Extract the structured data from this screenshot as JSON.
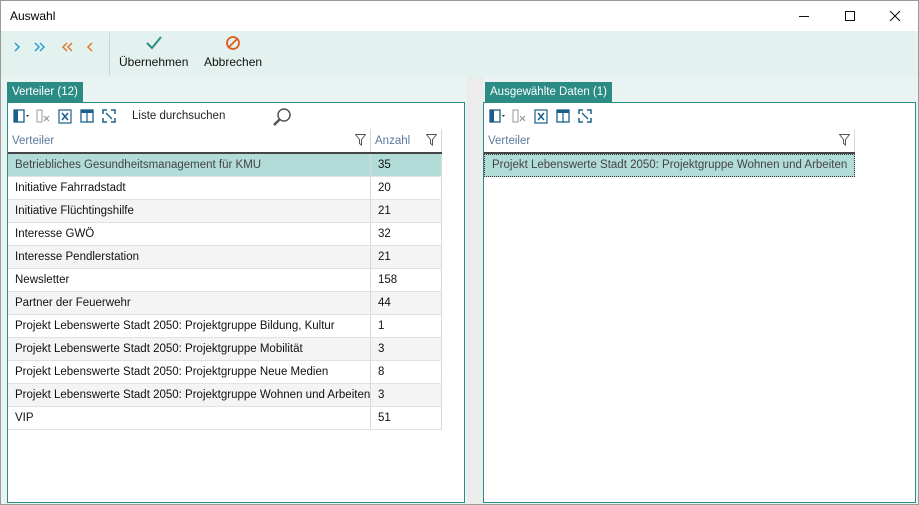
{
  "window": {
    "title": "Auswahl"
  },
  "toolbar": {
    "accept_label": "Übernehmen",
    "cancel_label": "Abbrechen",
    "accent_color": "#2b8c86",
    "nav_color_add": "#2a9fd6",
    "nav_color_remove": "#e07b2a"
  },
  "left_pane": {
    "tab_label": "Verteiler (12)",
    "search_label": "Liste durchsuchen",
    "columns": [
      "Verteiler",
      "Anzahl"
    ],
    "rows": [
      {
        "name": "Betriebliches Gesundheitsmanagement für KMU",
        "count": "35",
        "selected": true
      },
      {
        "name": "Initiative Fahrradstadt",
        "count": "20"
      },
      {
        "name": "Initiative Flüchtingshilfe",
        "count": "21"
      },
      {
        "name": "Interesse GWÖ",
        "count": "32"
      },
      {
        "name": "Interesse Pendlerstation",
        "count": "21"
      },
      {
        "name": "Newsletter",
        "count": "158"
      },
      {
        "name": "Partner der Feuerwehr",
        "count": "44"
      },
      {
        "name": "Projekt Lebenswerte Stadt 2050: Projektgruppe Bildung, Kultur",
        "count": "1"
      },
      {
        "name": "Projekt Lebenswerte Stadt 2050: Projektgruppe Mobilität",
        "count": "3"
      },
      {
        "name": "Projekt Lebenswerte Stadt 2050: Projektgruppe Neue Medien",
        "count": "8"
      },
      {
        "name": "Projekt Lebenswerte Stadt 2050: Projektgruppe Wohnen und Arbeiten",
        "count": "3"
      },
      {
        "name": "VIP",
        "count": "51"
      }
    ]
  },
  "right_pane": {
    "tab_label": "Ausgewählte Daten (1)",
    "columns": [
      "Verteiler"
    ],
    "rows": [
      {
        "name": "Projekt Lebenswerte Stadt 2050: Projektgruppe Wohnen und Arbeiten"
      }
    ]
  }
}
